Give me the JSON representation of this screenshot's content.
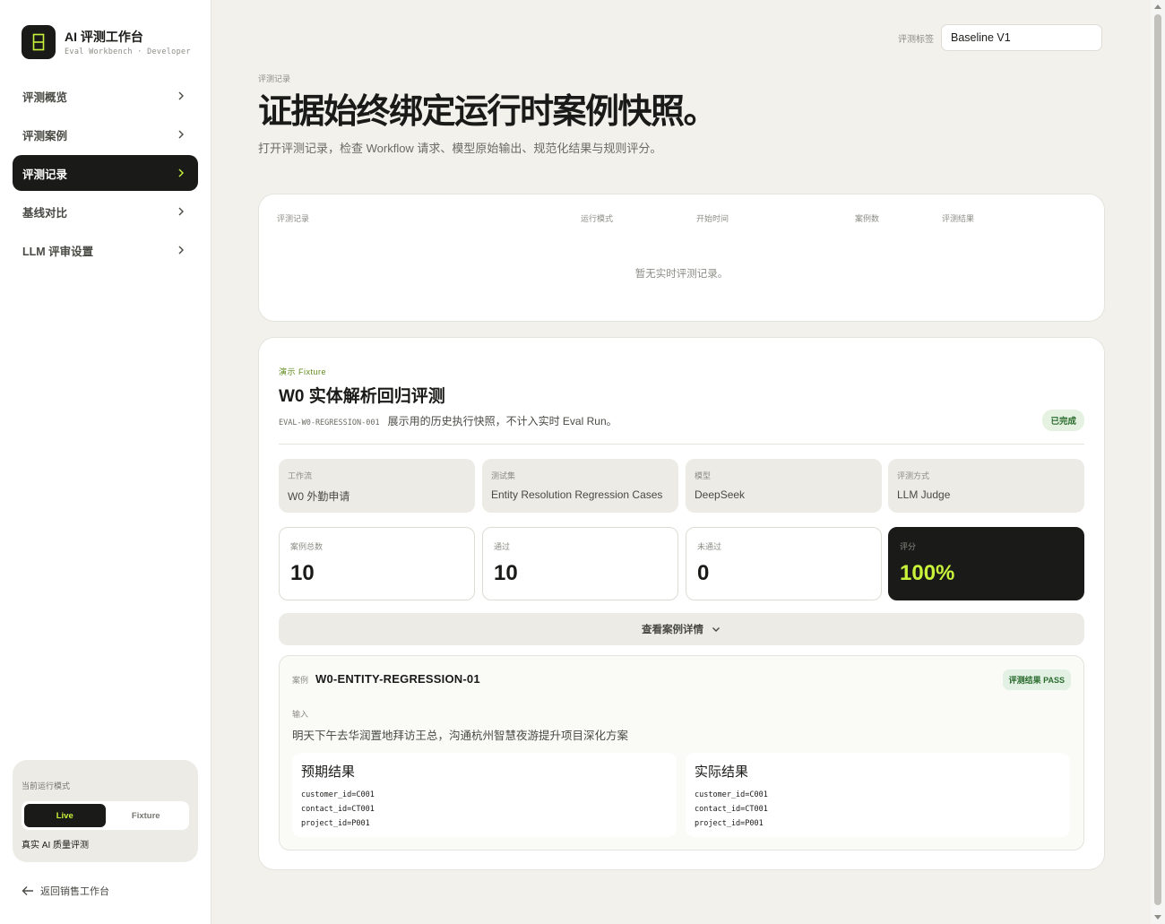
{
  "brand": {
    "title": "AI 评测工作台",
    "subtitle": "Eval Workbench · Developer"
  },
  "sidebar": {
    "items": [
      {
        "label": "评测概览",
        "active": false
      },
      {
        "label": "评测案例",
        "active": false
      },
      {
        "label": "评测记录",
        "active": true
      },
      {
        "label": "基线对比",
        "active": false
      },
      {
        "label": "LLM 评审设置",
        "active": false
      }
    ],
    "mode": {
      "label": "当前运行模式",
      "options": [
        "Live",
        "Fixture"
      ],
      "selected": "Live",
      "description": "真实 AI 质量评测"
    },
    "back_label": "返回销售工作台"
  },
  "tag": {
    "label": "评测标签",
    "value": "Baseline V1"
  },
  "header": {
    "eyebrow": "评测记录",
    "title": "证据始终绑定运行时案例快照。",
    "description": "打开评测记录，检查 Workflow 请求、模型原始输出、规范化结果与规则评分。"
  },
  "records": {
    "columns": [
      "评测记录",
      "运行模式",
      "开始时间",
      "案例数",
      "评测结果"
    ],
    "empty_text": "暂无实时评测记录。"
  },
  "fixture": {
    "eyebrow": "演示 Fixture",
    "title": "W0 实体解析回归评测",
    "code": "EVAL-W0-REGRESSION-001",
    "note": "展示用的历史执行快照，不计入实时 Eval Run。",
    "status": "已完成",
    "meta": [
      {
        "key": "工作流",
        "value": "W0 外勤申请"
      },
      {
        "key": "测试集",
        "value": "Entity Resolution Regression Cases"
      },
      {
        "key": "模型",
        "value": "DeepSeek"
      },
      {
        "key": "评测方式",
        "value": "LLM Judge"
      }
    ],
    "stats": [
      {
        "key": "案例总数",
        "value": "10"
      },
      {
        "key": "通过",
        "value": "10"
      },
      {
        "key": "未通过",
        "value": "0"
      },
      {
        "key": "评分",
        "value": "100%"
      }
    ],
    "details_label": "查看案例详情",
    "case": {
      "key": "案例",
      "id": "W0-ENTITY-REGRESSION-01",
      "badge": "评测结果 PASS",
      "input_key": "输入",
      "input_value": "明天下午去华润置地拜访王总，沟通杭州智慧夜游提升项目深化方案",
      "expected": {
        "title": "预期结果",
        "lines": [
          "customer_id=C001",
          "contact_id=CT001",
          "project_id=P001"
        ]
      },
      "actual": {
        "title": "实际结果",
        "lines": [
          "customer_id=C001",
          "contact_id=CT001",
          "project_id=P001"
        ]
      }
    }
  },
  "colors": {
    "accent": "#c9f23a",
    "dark": "#1a1b18",
    "background": "#f2f1ec",
    "success": "#2a6b2e"
  },
  "icons": {
    "logo": "sidebar-panel-icon",
    "nav": "chevron-right-icon",
    "back": "arrow-left-icon",
    "details": "chevron-down-icon"
  }
}
